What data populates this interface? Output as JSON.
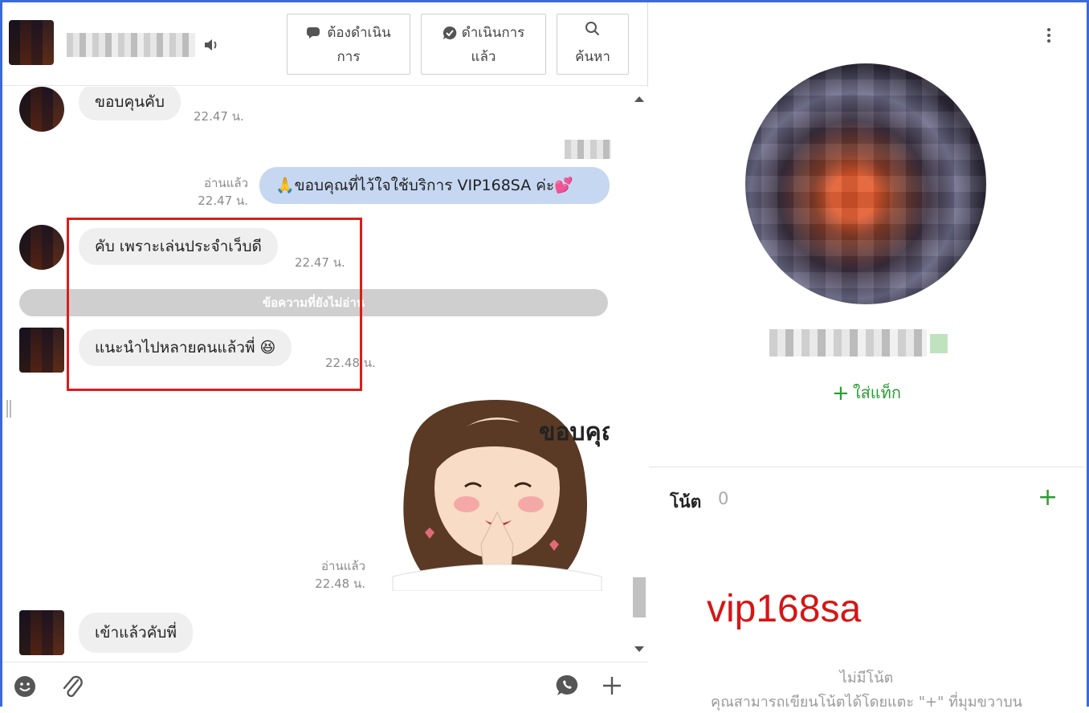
{
  "header": {
    "btn_todo_line1": "ต้องดำเนิน",
    "btn_todo_line2": "การ",
    "btn_done_line1": "ดำเนินการ",
    "btn_done_line2": "แล้ว",
    "btn_search": "ค้นหา"
  },
  "messages": [
    {
      "text": "ขอบคุนคับ",
      "time": "22.47 น."
    },
    {
      "read": "อ่านแล้ว",
      "time": "22.47 น.",
      "text": "🙏ขอบคุณที่ไว้ใจใช้บริการ VIP168SA ค่ะ💕"
    },
    {
      "text": "คับ เพราะเล่นประจำเว็บดี",
      "time": "22.47 น."
    },
    {
      "divider": "ข้อความที่ยังไม่อ่าน"
    },
    {
      "text": "แนะนำไปหลายคนแล้วพี่ 😆",
      "time": "22.48 น."
    },
    {
      "read": "อ่านแล้ว",
      "time": "22.48 น.",
      "sticker_text": "ขอบคุณค่ะ"
    },
    {
      "text": "เข้าแล้วคับพี่"
    }
  ],
  "side": {
    "add_tag": "ใส่แท็ก",
    "note_title": "โน้ต",
    "note_count": "0",
    "watermark": "vip168sa",
    "no_note": "ไม่มีโน้ต",
    "no_note_sub": "คุณสามารถเขียนโน้ตได้โดยแตะ \"+\" ที่มุมขวาบน"
  },
  "colors": {
    "accent_green": "#2a9c35",
    "outgoing_bubble": "#c6d7f2",
    "highlight_box": "#e01b1b",
    "watermark": "#d61515"
  },
  "icons": [
    "speaker-icon",
    "chat-bubble-icon",
    "check-bubble-icon",
    "search-icon",
    "kebab-menu-icon",
    "emoji-icon",
    "paperclip-icon",
    "line-call-icon",
    "plus-icon"
  ]
}
